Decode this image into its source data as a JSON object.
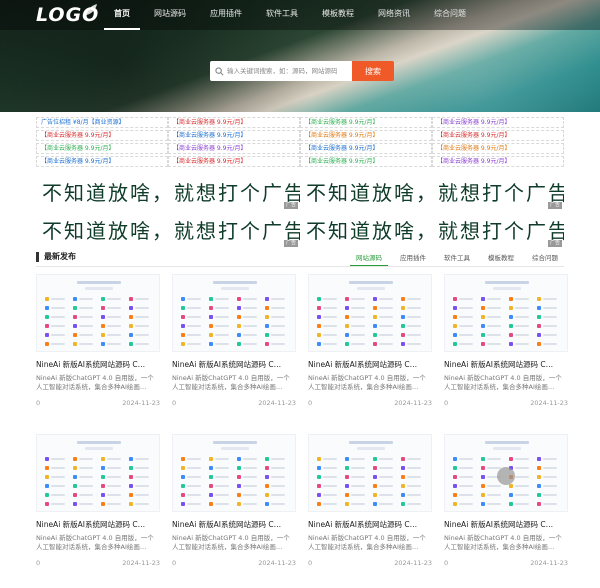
{
  "header": {
    "logo": "LOGO",
    "nav": [
      {
        "label": "首页",
        "active": true
      },
      {
        "label": "网站源码",
        "active": false
      },
      {
        "label": "应用插件",
        "active": false
      },
      {
        "label": "软件工具",
        "active": false
      },
      {
        "label": "模板教程",
        "active": false
      },
      {
        "label": "网络资讯",
        "active": false
      },
      {
        "label": "综合问题",
        "active": false
      }
    ],
    "search": {
      "placeholder": "输入关键词搜索，如：源码，网站源码",
      "button": "搜索"
    }
  },
  "text_ads": [
    [
      {
        "text": "广告位招租 ¥8/月【商业资源】",
        "color": "#1b6fd1"
      },
      {
        "text": "【商业云服务器 9.9元/月】",
        "color": "#d92c2c"
      },
      {
        "text": "【商业云服务器 9.9元/月】",
        "color": "#2bb04f"
      },
      {
        "text": "【商业云服务器 9.9元/月】",
        "color": "#8a3fd1"
      }
    ],
    [
      {
        "text": "【商业云服务器 9.9元/月】",
        "color": "#d92c2c"
      },
      {
        "text": "【商业云服务器 9.9元/月】",
        "color": "#1b6fd1"
      },
      {
        "text": "【商业云服务器 9.9元/月】",
        "color": "#e07a12"
      },
      {
        "text": "【商业云服务器 9.9元/月】",
        "color": "#d92c2c"
      }
    ],
    [
      {
        "text": "【商业云服务器 9.9元/月】",
        "color": "#2bb04f"
      },
      {
        "text": "【商业云服务器 9.9元/月】",
        "color": "#8a3fd1"
      },
      {
        "text": "【商业云服务器 9.9元/月】",
        "color": "#1b6fd1"
      },
      {
        "text": "【商业云服务器 9.9元/月】",
        "color": "#e07a12"
      }
    ],
    [
      {
        "text": "【商业云服务器 9.9元/月】",
        "color": "#1b6fd1"
      },
      {
        "text": "【商业云服务器 9.9元/月】",
        "color": "#d92c2c"
      },
      {
        "text": "【商业云服务器 9.9元/月】",
        "color": "#2bb04f"
      },
      {
        "text": "【商业云服务器 9.9元/月】",
        "color": "#8a3fd1"
      }
    ]
  ],
  "banners": [
    [
      "不知道放啥，就想打个广告",
      "不知道放啥，就想打个广告"
    ],
    [
      "不知道放啥，就想打个广告",
      "不知道放啥，就想打个广告"
    ]
  ],
  "banner_tag": "广告",
  "section": {
    "title": "最新发布",
    "filters": [
      {
        "label": "网站源码",
        "active": true
      },
      {
        "label": "应用插件",
        "active": false
      },
      {
        "label": "软件工具",
        "active": false
      },
      {
        "label": "模板教程",
        "active": false
      },
      {
        "label": "综合问题",
        "active": false
      }
    ]
  },
  "cards": [
    {
      "title": "NineAi 新版AI系统网站源码 C…",
      "desc": "NineAi 新版ChatGPT 4.0 自用版，一个人工智能对话系统，集合多种AI绘画…",
      "views": "0",
      "date": "2024-11-23"
    },
    {
      "title": "NineAi 新版AI系统网站源码 C…",
      "desc": "NineAi 新版ChatGPT 4.0 自用版，一个人工智能对话系统，集合多种AI绘画…",
      "views": "0",
      "date": "2024-11-23"
    },
    {
      "title": "NineAi 新版AI系统网站源码 C…",
      "desc": "NineAi 新版ChatGPT 4.0 自用版，一个人工智能对话系统，集合多种AI绘画…",
      "views": "0",
      "date": "2024-11-23"
    },
    {
      "title": "NineAi 新版AI系统网站源码 C…",
      "desc": "NineAi 新版ChatGPT 4.0 自用版，一个人工智能对话系统，集合多种AI绘画…",
      "views": "0",
      "date": "2024-11-23"
    },
    {
      "title": "NineAi 新版AI系统网站源码 C…",
      "desc": "NineAi 新版ChatGPT 4.0 自用版，一个人工智能对话系统，集合多种AI绘画…",
      "views": "0",
      "date": "2024-11-23"
    },
    {
      "title": "NineAi 新版AI系统网站源码 C…",
      "desc": "NineAi 新版ChatGPT 4.0 自用版，一个人工智能对话系统，集合多种AI绘画…",
      "views": "0",
      "date": "2024-11-23"
    },
    {
      "title": "NineAi 新版AI系统网站源码 C…",
      "desc": "NineAi 新版ChatGPT 4.0 自用版，一个人工智能对话系统，集合多种AI绘画…",
      "views": "0",
      "date": "2024-11-23"
    },
    {
      "title": "NineAi 新版AI系统网站源码 C…",
      "desc": "NineAi 新版ChatGPT 4.0 自用版，一个人工智能对话系统，集合多种AI绘画…",
      "views": "0",
      "date": "2024-11-23"
    }
  ],
  "colors": {
    "accent": "#2a9d3a",
    "search_button": "#f05a28"
  }
}
